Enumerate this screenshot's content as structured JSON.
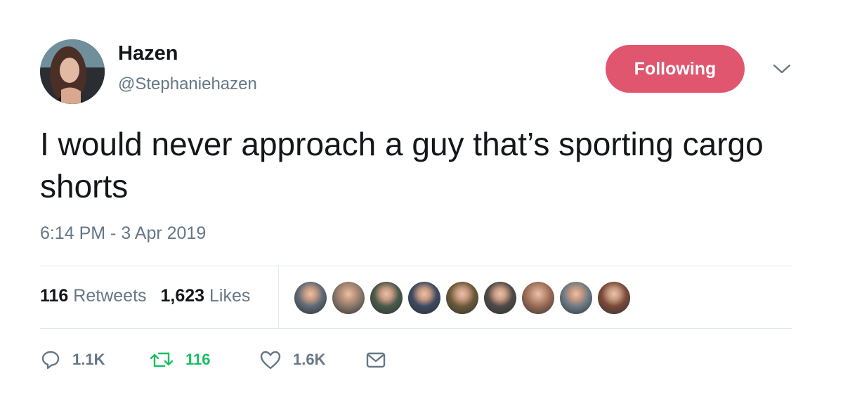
{
  "author": {
    "name": "Hazen",
    "handle": "@Stephaniehazen"
  },
  "follow_button": {
    "label": "Following",
    "color": "#e0566f"
  },
  "tweet": {
    "text": "I would never approach a guy that’s sporting cargo shorts",
    "timestamp": "6:14 PM - 3 Apr 2019"
  },
  "stats": {
    "retweets_count": "116",
    "retweets_label": "Retweets",
    "likes_count": "1,623",
    "likes_label": "Likes"
  },
  "likers": [
    {
      "icon": "avatar-photo",
      "color": "#5e6a76"
    },
    {
      "icon": "avatar-photo",
      "color": "#8c7a6b"
    },
    {
      "icon": "avatar-photo",
      "color": "#4a5a4a"
    },
    {
      "icon": "avatar-photo",
      "color": "#3d4a63"
    },
    {
      "icon": "avatar-photo",
      "color": "#6b5a3a"
    },
    {
      "icon": "avatar-photo",
      "color": "#4f4a48"
    },
    {
      "icon": "avatar-photo",
      "color": "#9a6b55"
    },
    {
      "icon": "avatar-photo",
      "color": "#6e7b86"
    },
    {
      "icon": "avatar-photo",
      "color": "#7a4a3a"
    }
  ],
  "actions": {
    "reply_count": "1.1K",
    "retweet_count": "116",
    "like_count": "1.6K"
  },
  "colors": {
    "text_primary": "#14171a",
    "text_secondary": "#657786",
    "retweet_green": "#17bf63",
    "divider": "#e1e8ed"
  }
}
